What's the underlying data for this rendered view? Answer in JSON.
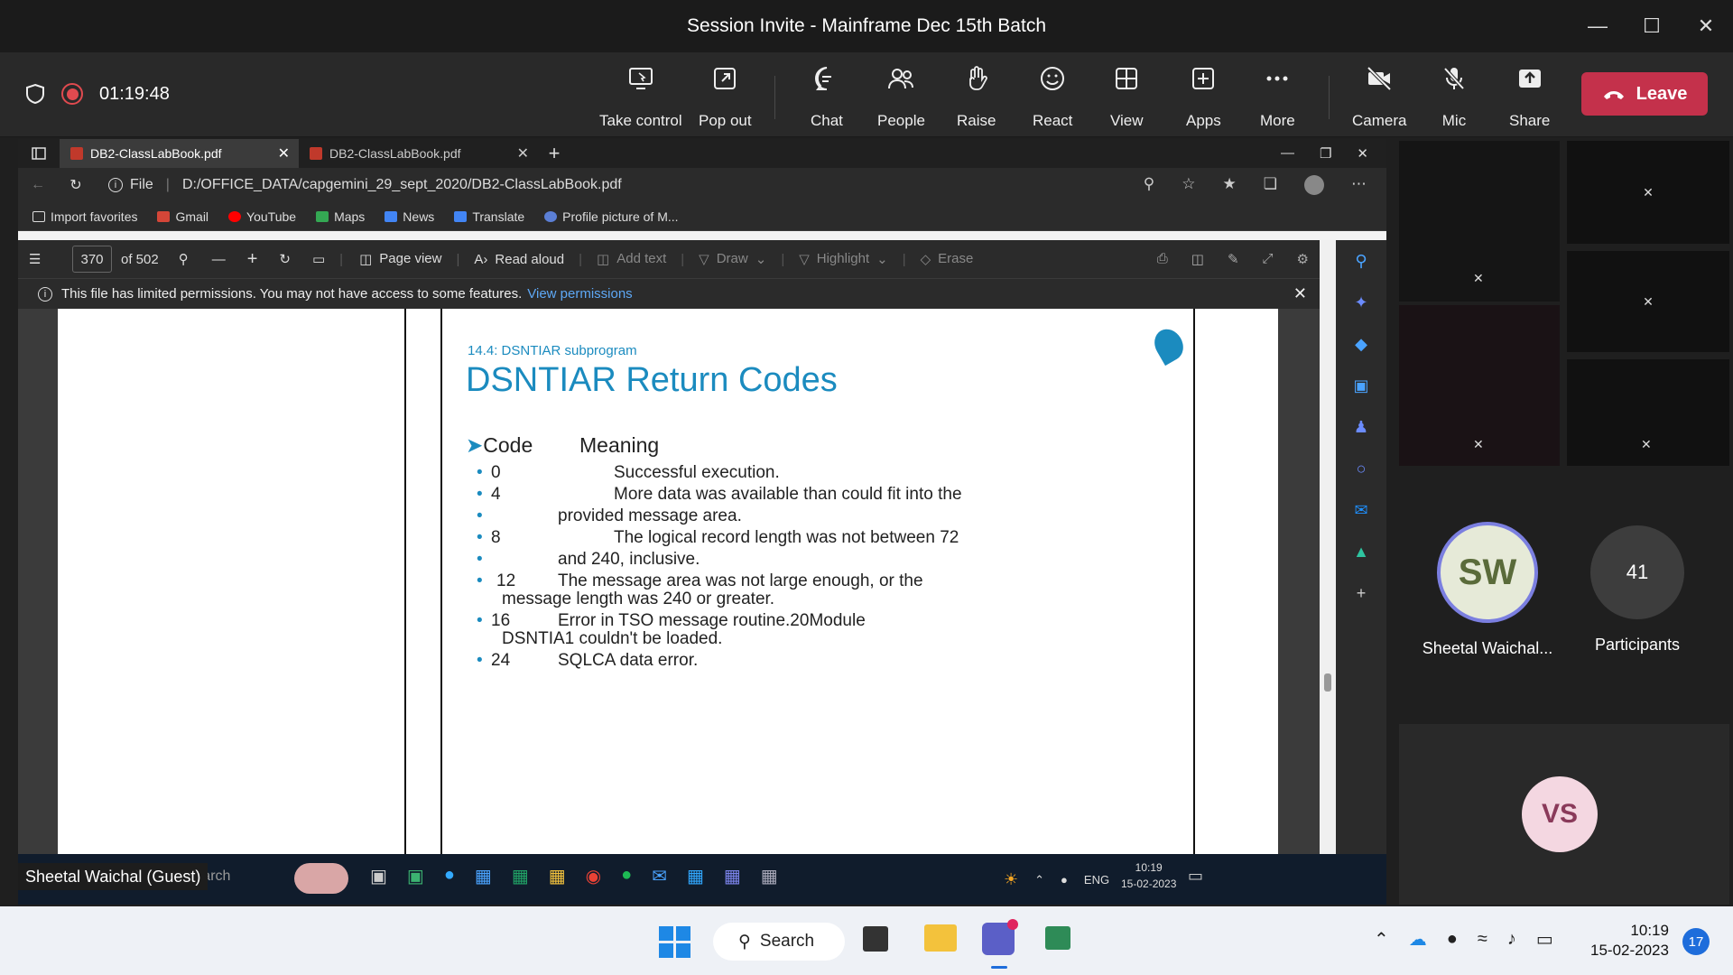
{
  "window": {
    "title": "Session Invite - Mainframe Dec 15th Batch"
  },
  "meeting": {
    "timer": "01:19:48"
  },
  "toolbar": {
    "items": [
      {
        "label": "Take control",
        "icon": "take-control-icon"
      },
      {
        "label": "Pop out",
        "icon": "pop-out-icon"
      },
      {
        "label": "Chat",
        "icon": "chat-icon"
      },
      {
        "label": "People",
        "icon": "people-icon"
      },
      {
        "label": "Raise",
        "icon": "raise-hand-icon"
      },
      {
        "label": "React",
        "icon": "react-icon"
      },
      {
        "label": "View",
        "icon": "view-icon"
      },
      {
        "label": "Apps",
        "icon": "apps-icon"
      },
      {
        "label": "More",
        "icon": "more-icon"
      },
      {
        "label": "Camera",
        "icon": "camera-off-icon"
      },
      {
        "label": "Mic",
        "icon": "mic-off-icon"
      },
      {
        "label": "Share",
        "icon": "share-icon"
      }
    ],
    "leave": "Leave"
  },
  "browser": {
    "tabs": [
      "DB2-ClassLabBook.pdf",
      "DB2-ClassLabBook.pdf"
    ],
    "address_scheme": "File",
    "address": "D:/OFFICE_DATA/capgemini_29_sept_2020/DB2-ClassLabBook.pdf",
    "favorites": [
      "Import favorites",
      "Gmail",
      "YouTube",
      "Maps",
      "News",
      "Translate",
      "Profile picture of M..."
    ],
    "pdf": {
      "page": "370",
      "of": "of 502",
      "page_view": "Page view",
      "read_aloud": "Read aloud",
      "add_text": "Add text",
      "draw": "Draw",
      "highlight": "Highlight",
      "erase": "Erase"
    },
    "notice": "This file has limited permissions. You may not have access to some features.",
    "notice_link": "View permissions"
  },
  "slide": {
    "section": "14.4: DSNTIAR subprogram",
    "title": "DSNTIAR Return Codes",
    "header_code": "Code",
    "header_meaning": "Meaning",
    "rows": [
      {
        "code": "0",
        "line1": "Successful execution.",
        "line2": ""
      },
      {
        "code": "4",
        "line1": "More data was available than could fit into the",
        "line2": "provided message area."
      },
      {
        "code": "8",
        "line1": "The logical record length was not between 72",
        "line2": "and 240, inclusive."
      },
      {
        "code": "12",
        "line1": "The message area was not large enough, or the",
        "line2": "message length was 240 or greater."
      },
      {
        "code": "16",
        "line1": "Error in TSO message routine.20Module",
        "line2": "DSNTIA1 couldn't be loaded."
      },
      {
        "code": "24",
        "line1": "SQLCA data error.",
        "line2": ""
      }
    ]
  },
  "inner_taskbar": {
    "search_placeholder": "Type here to search",
    "lang": "ENG",
    "time": "10:19",
    "date": "15-02-2023"
  },
  "guest_label": "Sheetal Waichal (Guest)",
  "participants": {
    "presenter_initials": "SW",
    "presenter_name": "Sheetal Waichal...",
    "count": "41",
    "count_label": "Participants",
    "other_initials": "VS"
  },
  "taskbar": {
    "search": "Search",
    "time": "10:19",
    "date": "15-02-2023",
    "badge": "17"
  }
}
